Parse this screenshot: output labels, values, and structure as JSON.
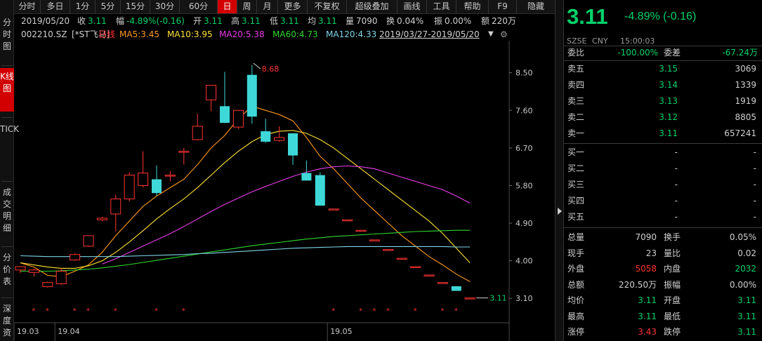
{
  "side_tabs": [
    "分时图",
    "K线图",
    "TICK",
    "成交明细",
    "分价表",
    "深度资"
  ],
  "toolbar": {
    "items": [
      "分时",
      "多日",
      "1分",
      "5分",
      "15分",
      "30分",
      "60分",
      "日",
      "周",
      "月",
      "更多",
      "不复权",
      "超级叠加",
      "画线",
      "工具",
      "帮助",
      "F9",
      "隐藏"
    ],
    "active": "日"
  },
  "info_bar": {
    "date": "2019/05/20",
    "close_label": "收",
    "close": "3.11",
    "range_label": "幅",
    "range": "-4.89%(-0.16)",
    "open_label": "开",
    "open": "3.11",
    "high_label": "高",
    "high": "3.11",
    "low_label": "低",
    "low": "3.11",
    "avg_label": "均",
    "avg": "3.11",
    "vol_label": "量",
    "vol": "7090",
    "turnover_label": "换",
    "turnover": "0.04%",
    "amplitude_label": "振",
    "amplitude": "0.00%",
    "amount_label": "额",
    "amount": "220万"
  },
  "ma_bar": {
    "code": "002210.SZ",
    "name": "[*ST飞马]",
    "period": "日线",
    "ma5": "MA5:3.45",
    "ma10": "MA10:3.95",
    "ma20": "MA20:5.38",
    "ma60": "MA60:4.73",
    "ma120": "MA120:4.33",
    "date_range": "2019/03/27-2019/05/20",
    "colors": {
      "ma5": "#ff9a1f",
      "ma10": "#ffe135",
      "ma20": "#e83ee8",
      "ma60": "#2fd62f",
      "ma120": "#7fd4e8",
      "period": "#ff3333"
    }
  },
  "chart_data": {
    "type": "candlestick",
    "y_ticks": [
      "8.50",
      "7.60",
      "6.70",
      "5.80",
      "4.90",
      "4.00",
      "3.10"
    ],
    "ylim": [
      2.55,
      9.2
    ],
    "x_ticks": [
      {
        "label": "19.03",
        "idx": 0
      },
      {
        "label": "19.04",
        "idx": 3
      },
      {
        "label": "19.05",
        "idx": 23
      }
    ],
    "max_label": "8.68",
    "last_label": "3.11",
    "candles": [
      {
        "o": 3.78,
        "h": 3.86,
        "l": 3.7,
        "c": 3.86
      },
      {
        "o": 3.72,
        "h": 3.81,
        "l": 3.62,
        "c": 3.78
      },
      {
        "o": 3.38,
        "h": 3.5,
        "l": 3.36,
        "c": 3.48
      },
      {
        "o": 3.45,
        "h": 3.82,
        "l": 3.42,
        "c": 3.75
      },
      {
        "o": 4.02,
        "h": 4.18,
        "l": 4.0,
        "c": 4.15
      },
      {
        "o": 4.35,
        "h": 4.6,
        "l": 4.33,
        "c": 4.6
      },
      {
        "o": 4.98,
        "h": 5.05,
        "l": 4.95,
        "c": 5.02
      },
      {
        "o": 5.12,
        "h": 5.58,
        "l": 4.7,
        "c": 5.48
      },
      {
        "o": 5.48,
        "h": 6.12,
        "l": 5.42,
        "c": 6.05
      },
      {
        "o": 5.8,
        "h": 6.62,
        "l": 5.75,
        "c": 6.1
      },
      {
        "o": 5.95,
        "h": 6.28,
        "l": 5.55,
        "c": 5.62
      },
      {
        "o": 6.05,
        "h": 6.15,
        "l": 5.9,
        "c": 6.05
      },
      {
        "o": 6.62,
        "h": 6.7,
        "l": 6.3,
        "c": 6.62
      },
      {
        "o": 6.9,
        "h": 7.52,
        "l": 6.88,
        "c": 7.22
      },
      {
        "o": 7.85,
        "h": 8.0,
        "l": 7.58,
        "c": 8.2
      },
      {
        "o": 7.7,
        "h": 8.52,
        "l": 7.3,
        "c": 7.3
      },
      {
        "o": 7.2,
        "h": 7.6,
        "l": 7.15,
        "c": 7.6
      },
      {
        "o": 8.45,
        "h": 8.68,
        "l": 7.28,
        "c": 7.45
      },
      {
        "o": 7.1,
        "h": 7.4,
        "l": 6.82,
        "c": 6.85
      },
      {
        "o": 6.88,
        "h": 7.22,
        "l": 6.85,
        "c": 6.95
      },
      {
        "o": 7.05,
        "h": 7.05,
        "l": 6.3,
        "c": 6.52
      },
      {
        "o": 6.1,
        "h": 6.4,
        "l": 6.0,
        "c": 5.92
      },
      {
        "o": 6.05,
        "h": 6.12,
        "l": 5.35,
        "c": 5.32
      },
      {
        "o": 5.24,
        "h": 5.24,
        "l": 5.24,
        "c": 5.24
      },
      {
        "o": 4.98,
        "h": 4.98,
        "l": 4.98,
        "c": 4.98
      },
      {
        "o": 4.73,
        "h": 4.73,
        "l": 4.73,
        "c": 4.73
      },
      {
        "o": 4.5,
        "h": 4.5,
        "l": 4.5,
        "c": 4.5
      },
      {
        "o": 4.27,
        "h": 4.27,
        "l": 4.27,
        "c": 4.27
      },
      {
        "o": 4.06,
        "h": 4.06,
        "l": 4.06,
        "c": 4.06
      },
      {
        "o": 3.86,
        "h": 3.86,
        "l": 3.86,
        "c": 3.86
      },
      {
        "o": 3.66,
        "h": 3.66,
        "l": 3.66,
        "c": 3.66
      },
      {
        "o": 3.48,
        "h": 3.48,
        "l": 3.48,
        "c": 3.48
      },
      {
        "o": 3.39,
        "h": 3.39,
        "l": 3.28,
        "c": 3.28
      },
      {
        "o": 3.11,
        "h": 3.11,
        "l": 3.11,
        "c": 3.11
      }
    ],
    "ma_series": [
      {
        "name": "MA5",
        "color": "#ff9a1f",
        "values": [
          3.95,
          3.85,
          3.65,
          3.62,
          3.75,
          3.9,
          4.2,
          4.6,
          4.95,
          5.3,
          5.55,
          5.75,
          5.95,
          6.3,
          6.7,
          7.0,
          7.4,
          7.7,
          7.6,
          7.5,
          7.35,
          6.95,
          6.5,
          6.2,
          5.85,
          5.5,
          5.2,
          4.9,
          4.6,
          4.35,
          4.1,
          3.9,
          3.68,
          3.5
        ]
      },
      {
        "name": "MA10",
        "color": "#ffe135",
        "values": [
          3.95,
          3.9,
          3.85,
          3.82,
          3.82,
          3.88,
          4.0,
          4.2,
          4.45,
          4.72,
          5.0,
          5.25,
          5.48,
          5.75,
          6.05,
          6.35,
          6.62,
          6.85,
          7.02,
          7.1,
          7.12,
          7.05,
          6.9,
          6.7,
          6.45,
          6.2,
          5.95,
          5.7,
          5.45,
          5.2,
          4.95,
          4.65,
          4.3,
          3.95
        ]
      },
      {
        "name": "MA20",
        "color": "#e83ee8",
        "values": [
          null,
          null,
          null,
          null,
          null,
          null,
          3.92,
          4.05,
          4.2,
          4.35,
          4.5,
          4.65,
          4.82,
          5.0,
          5.18,
          5.35,
          5.5,
          5.65,
          5.78,
          5.9,
          6.02,
          6.12,
          6.2,
          6.25,
          6.27,
          6.25,
          6.2,
          6.1,
          6.0,
          5.9,
          5.8,
          5.7,
          5.55,
          5.38
        ]
      },
      {
        "name": "MA60",
        "color": "#2fd62f",
        "values": [
          3.75,
          3.75,
          3.75,
          3.76,
          3.78,
          3.8,
          3.83,
          3.87,
          3.91,
          3.96,
          4.01,
          4.06,
          4.11,
          4.16,
          4.21,
          4.26,
          4.31,
          4.36,
          4.4,
          4.44,
          4.48,
          4.52,
          4.55,
          4.58,
          4.6,
          4.62,
          4.64,
          4.66,
          4.68,
          4.7,
          4.71,
          4.72,
          4.73,
          4.73
        ]
      },
      {
        "name": "MA120",
        "color": "#7fd4e8",
        "values": [
          4.12,
          4.11,
          4.1,
          4.1,
          4.1,
          4.1,
          4.1,
          4.1,
          4.11,
          4.12,
          4.13,
          4.14,
          4.15,
          4.17,
          4.18,
          4.2,
          4.22,
          4.24,
          4.26,
          4.28,
          4.3,
          4.31,
          4.32,
          4.33,
          4.34,
          4.34,
          4.34,
          4.34,
          4.34,
          4.34,
          4.34,
          4.34,
          4.33,
          4.33
        ]
      }
    ],
    "star_idx": [
      1,
      2,
      4,
      5,
      7,
      10,
      12,
      23,
      25,
      26,
      27,
      29,
      31,
      32
    ]
  },
  "quote": {
    "price": "3.11",
    "change": "-4.89% (-0.16)",
    "exchange": "SZSE",
    "currency": "CNY",
    "time": "15:00:03",
    "weibi_label": "委比",
    "weibi": "-100.00%",
    "weicha_label": "委差",
    "weicha": "-67.24万",
    "asks": [
      {
        "label": "卖五",
        "price": "3.15",
        "vol": "3069"
      },
      {
        "label": "卖四",
        "price": "3.14",
        "vol": "1339"
      },
      {
        "label": "卖三",
        "price": "3.13",
        "vol": "1919"
      },
      {
        "label": "卖二",
        "price": "3.12",
        "vol": "8805"
      },
      {
        "label": "卖一",
        "price": "3.11",
        "vol": "657241"
      }
    ],
    "bids": [
      {
        "label": "买一",
        "price": "-",
        "vol": "-"
      },
      {
        "label": "买二",
        "price": "-",
        "vol": "-"
      },
      {
        "label": "买三",
        "price": "-",
        "vol": "-"
      },
      {
        "label": "买四",
        "price": "-",
        "vol": "-"
      },
      {
        "label": "买五",
        "price": "-",
        "vol": "-"
      }
    ],
    "stats": [
      {
        "l1": "总量",
        "v1": "7090",
        "c1": "w",
        "l2": "换手",
        "v2": "0.05%",
        "c2": "w"
      },
      {
        "l1": "现手",
        "v1": "23",
        "c1": "w",
        "l2": "量比",
        "v2": "0.02",
        "c2": "w"
      },
      {
        "l1": "外盘",
        "v1": "5058",
        "c1": "r",
        "l2": "内盘",
        "v2": "2032",
        "c2": "g"
      },
      {
        "l1": "总额",
        "v1": "220.50万",
        "c1": "w",
        "l2": "振幅",
        "v2": "0.00%",
        "c2": "w"
      },
      {
        "l1": "均价",
        "v1": "3.11",
        "c1": "g",
        "l2": "开盘",
        "v2": "3.11",
        "c2": "g"
      },
      {
        "l1": "最高",
        "v1": "3.11",
        "c1": "g",
        "l2": "最低",
        "v2": "3.11",
        "c2": "g"
      },
      {
        "l1": "涨停",
        "v1": "3.43",
        "c1": "r",
        "l2": "跌停",
        "v2": "3.11",
        "c2": "g"
      }
    ]
  }
}
